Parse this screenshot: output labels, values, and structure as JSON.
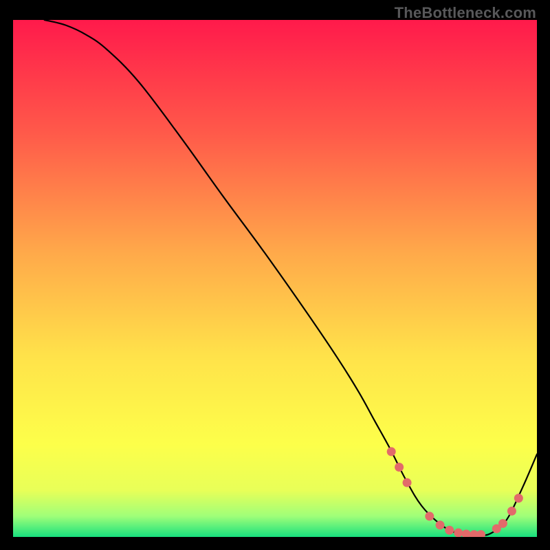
{
  "watermark": "TheBottleneck.com",
  "chart_data": {
    "type": "line",
    "title": "",
    "xlabel": "",
    "ylabel": "",
    "xlim": [
      0,
      100
    ],
    "ylim": [
      0,
      100
    ],
    "gradient_stops": [
      {
        "offset": 0,
        "color": "#ff1a4b"
      },
      {
        "offset": 22,
        "color": "#ff5a4a"
      },
      {
        "offset": 45,
        "color": "#ffa94a"
      },
      {
        "offset": 65,
        "color": "#ffe24a"
      },
      {
        "offset": 82,
        "color": "#fdff4a"
      },
      {
        "offset": 91,
        "color": "#e8ff58"
      },
      {
        "offset": 96,
        "color": "#9fff79"
      },
      {
        "offset": 100,
        "color": "#18e07e"
      }
    ],
    "series": [
      {
        "name": "bottleneck-curve",
        "stroke": "#000000",
        "x": [
          6.0,
          10.0,
          14.0,
          18.0,
          24.0,
          32.0,
          40.0,
          48.0,
          56.0,
          62.0,
          66.0,
          69.0,
          72.0,
          75.0,
          78.0,
          81.5,
          84.5,
          87.0,
          89.0,
          91.0,
          94.0,
          97.0,
          100.0
        ],
        "y": [
          100.0,
          99.0,
          97.1,
          94.2,
          88.0,
          77.3,
          66.0,
          55.0,
          43.5,
          34.5,
          28.0,
          22.5,
          17.0,
          11.0,
          6.0,
          2.5,
          0.8,
          0.4,
          0.4,
          0.6,
          3.0,
          9.0,
          16.0
        ]
      }
    ],
    "markers": {
      "name": "highlight-dots",
      "color": "#e26a6a",
      "points": [
        {
          "x": 72.2,
          "y": 16.5
        },
        {
          "x": 73.7,
          "y": 13.5
        },
        {
          "x": 75.2,
          "y": 10.5
        },
        {
          "x": 79.5,
          "y": 4.0
        },
        {
          "x": 81.5,
          "y": 2.3
        },
        {
          "x": 83.3,
          "y": 1.3
        },
        {
          "x": 85.0,
          "y": 0.8
        },
        {
          "x": 86.5,
          "y": 0.55
        },
        {
          "x": 88.0,
          "y": 0.45
        },
        {
          "x": 89.3,
          "y": 0.45
        },
        {
          "x": 92.3,
          "y": 1.6
        },
        {
          "x": 93.5,
          "y": 2.6
        },
        {
          "x": 95.2,
          "y": 5.0
        },
        {
          "x": 96.5,
          "y": 7.5
        }
      ]
    }
  }
}
